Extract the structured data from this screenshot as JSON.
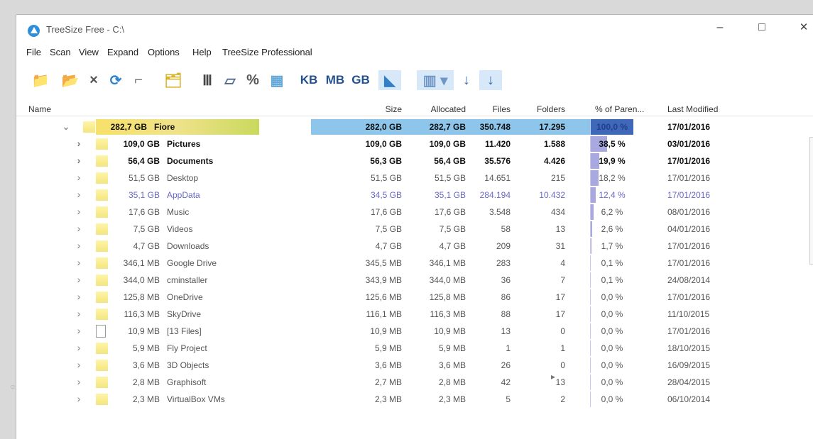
{
  "window": {
    "title": "TreeSize Free - C:\\",
    "minimize_icon": "–",
    "maximize_icon": "□",
    "close_icon": "×"
  },
  "menu": [
    "File",
    "Scan",
    "View",
    "Expand",
    "Options",
    "Help",
    "TreeSize Professional"
  ],
  "toolbar": {
    "buttons": [
      {
        "name": "select-drive-icon",
        "glyph": "📁"
      },
      {
        "name": "scan-drive-icon",
        "glyph": "📂"
      },
      {
        "name": "cancel-icon",
        "glyph": "×"
      },
      {
        "name": "refresh-icon",
        "glyph": "⟳"
      },
      {
        "name": "drive-icon",
        "glyph": "⌐"
      },
      {
        "name": "folder-icon",
        "glyph": "🗂"
      },
      {
        "name": "columns-icon",
        "glyph": "Ⅲ"
      },
      {
        "name": "size-view-icon",
        "glyph": "▱"
      },
      {
        "name": "percent-icon",
        "glyph": "%"
      },
      {
        "name": "table-view-icon",
        "glyph": "▦"
      },
      {
        "name": "kb-button",
        "label": "KB"
      },
      {
        "name": "mb-button",
        "label": "MB"
      },
      {
        "name": "gb-button",
        "label": "GB"
      },
      {
        "name": "sort-chart-icon",
        "glyph": "◣"
      },
      {
        "name": "list-dropdown-icon",
        "glyph": "▥ ▾"
      },
      {
        "name": "sort-ascending-icon",
        "glyph": "↓"
      },
      {
        "name": "sort-descending-icon",
        "glyph": "↓"
      }
    ]
  },
  "columns": [
    "Name",
    "Size",
    "Allocated",
    "Files",
    "Folders",
    "% of Paren...",
    "Last Modified"
  ],
  "rows": [
    {
      "expander": "⌄",
      "icon": "folder",
      "name_size": "282,7 GB",
      "name": "Fiore",
      "size": "282,0 GB",
      "allocated": "282,7 GB",
      "files": "350.748",
      "folders": "17.295",
      "percent_text": "100,0 %",
      "percent": 100,
      "modified": "17/01/2016",
      "style": "selected"
    },
    {
      "expander": "›",
      "icon": "folder",
      "name_size": "109,0 GB",
      "name": "Pictures",
      "size": "109,0 GB",
      "allocated": "109,0 GB",
      "files": "11.420",
      "folders": "1.588",
      "percent_text": "38,5 %",
      "percent": 38.5,
      "modified": "03/01/2016",
      "style": "bold"
    },
    {
      "expander": "›",
      "icon": "folder",
      "name_size": "56,4 GB",
      "name": "Documents",
      "size": "56,3 GB",
      "allocated": "56,4 GB",
      "files": "35.576",
      "folders": "4.426",
      "percent_text": "19,9 %",
      "percent": 19.9,
      "modified": "17/01/2016",
      "style": "bold"
    },
    {
      "expander": "›",
      "icon": "folder",
      "name_size": "51,5 GB",
      "name": "Desktop",
      "size": "51,5 GB",
      "allocated": "51,5 GB",
      "files": "14.651",
      "folders": "215",
      "percent_text": "18,2 %",
      "percent": 18.2,
      "modified": "17/01/2016",
      "style": "normal"
    },
    {
      "expander": "›",
      "icon": "folder",
      "name_size": "35,1 GB",
      "name": "AppData",
      "size": "34,5 GB",
      "allocated": "35,1 GB",
      "files": "284.194",
      "folders": "10.432",
      "percent_text": "12,4 %",
      "percent": 12.4,
      "modified": "17/01/2016",
      "style": "appdata"
    },
    {
      "expander": "›",
      "icon": "folder",
      "name_size": "17,6 GB",
      "name": "Music",
      "size": "17,6 GB",
      "allocated": "17,6 GB",
      "files": "3.548",
      "folders": "434",
      "percent_text": "6,2 %",
      "percent": 6.2,
      "modified": "08/01/2016",
      "style": "normal"
    },
    {
      "expander": "›",
      "icon": "folder",
      "name_size": "7,5 GB",
      "name": "Videos",
      "size": "7,5 GB",
      "allocated": "7,5 GB",
      "files": "58",
      "folders": "13",
      "percent_text": "2,6 %",
      "percent": 2.6,
      "modified": "04/01/2016",
      "style": "normal"
    },
    {
      "expander": "›",
      "icon": "folder",
      "name_size": "4,7 GB",
      "name": "Downloads",
      "size": "4,7 GB",
      "allocated": "4,7 GB",
      "files": "209",
      "folders": "31",
      "percent_text": "1,7 %",
      "percent": 1.7,
      "modified": "17/01/2016",
      "style": "normal"
    },
    {
      "expander": "›",
      "icon": "folder",
      "name_size": "346,1 MB",
      "name": "Google Drive",
      "size": "345,5 MB",
      "allocated": "346,1 MB",
      "files": "283",
      "folders": "4",
      "percent_text": "0,1 %",
      "percent": 0.1,
      "modified": "17/01/2016",
      "style": "normal"
    },
    {
      "expander": "›",
      "icon": "folder",
      "name_size": "344,0 MB",
      "name": "cminstaller",
      "size": "343,9 MB",
      "allocated": "344,0 MB",
      "files": "36",
      "folders": "7",
      "percent_text": "0,1 %",
      "percent": 0.1,
      "modified": "24/08/2014",
      "style": "normal"
    },
    {
      "expander": "›",
      "icon": "folder",
      "name_size": "125,8 MB",
      "name": "OneDrive",
      "size": "125,6 MB",
      "allocated": "125,8 MB",
      "files": "86",
      "folders": "17",
      "percent_text": "0,0 %",
      "percent": 0,
      "modified": "17/01/2016",
      "style": "normal"
    },
    {
      "expander": "›",
      "icon": "folder",
      "name_size": "116,3 MB",
      "name": "SkyDrive",
      "size": "116,1 MB",
      "allocated": "116,3 MB",
      "files": "88",
      "folders": "17",
      "percent_text": "0,0 %",
      "percent": 0,
      "modified": "11/10/2015",
      "style": "normal"
    },
    {
      "expander": "›",
      "icon": "file",
      "name_size": "10,9 MB",
      "name": "[13 Files]",
      "size": "10,9 MB",
      "allocated": "10,9 MB",
      "files": "13",
      "folders": "0",
      "percent_text": "0,0 %",
      "percent": 0,
      "modified": "17/01/2016",
      "style": "normal"
    },
    {
      "expander": "›",
      "icon": "folder",
      "name_size": "5,9 MB",
      "name": "Fly Project",
      "size": "5,9 MB",
      "allocated": "5,9 MB",
      "files": "1",
      "folders": "1",
      "percent_text": "0,0 %",
      "percent": 0,
      "modified": "18/10/2015",
      "style": "normal"
    },
    {
      "expander": "›",
      "icon": "folder",
      "name_size": "3,6 MB",
      "name": "3D Objects",
      "size": "3,6 MB",
      "allocated": "3,6 MB",
      "files": "26",
      "folders": "0",
      "percent_text": "0,0 %",
      "percent": 0,
      "modified": "16/09/2015",
      "style": "normal"
    },
    {
      "expander": "›",
      "icon": "folder",
      "name_size": "2,8 MB",
      "name": "Graphisoft",
      "size": "2,7 MB",
      "allocated": "2,8 MB",
      "files": "42",
      "folders": "13",
      "percent_text": "0,0 %",
      "percent": 0,
      "modified": "28/04/2015",
      "style": "normal"
    },
    {
      "expander": "›",
      "icon": "folder",
      "name_size": "2,3 MB",
      "name": "VirtualBox VMs",
      "size": "2,3 MB",
      "allocated": "2,3 MB",
      "files": "5",
      "folders": "2",
      "percent_text": "0,0 %",
      "percent": 0,
      "modified": "06/10/2014",
      "style": "normal"
    }
  ]
}
